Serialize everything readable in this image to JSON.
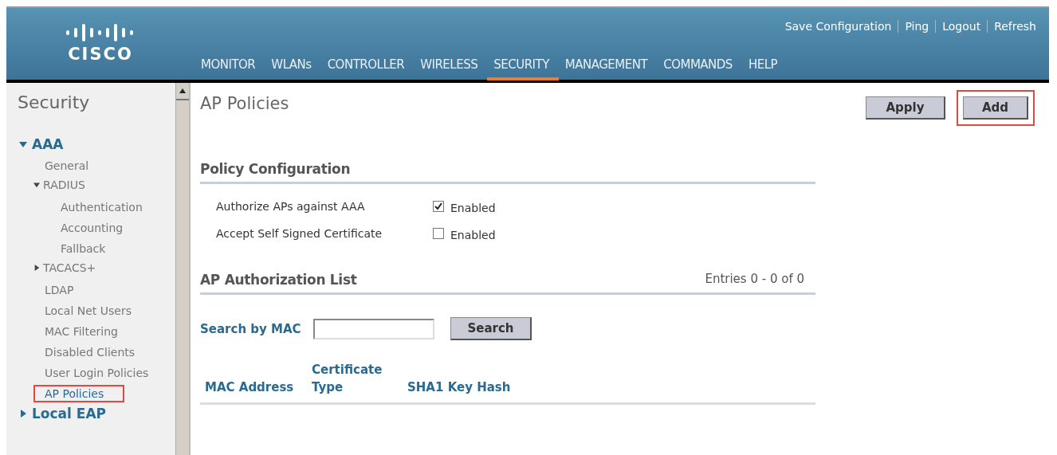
{
  "header": {
    "logo": "CISCO",
    "top_links": [
      "Save Configuration",
      "Ping",
      "Logout",
      "Refresh"
    ],
    "nav": [
      {
        "label": "MONITOR",
        "selected": false
      },
      {
        "label": "WLANs",
        "selected": false
      },
      {
        "label": "CONTROLLER",
        "selected": false
      },
      {
        "label": "WIRELESS",
        "selected": false
      },
      {
        "label": "SECURITY",
        "selected": true
      },
      {
        "label": "MANAGEMENT",
        "selected": false
      },
      {
        "label": "COMMANDS",
        "selected": false
      },
      {
        "label": "HELP",
        "selected": false
      }
    ]
  },
  "sidebar": {
    "title": "Security",
    "items": [
      {
        "label": "AAA",
        "kind": "section",
        "expanded": true,
        "children": [
          {
            "label": "General",
            "selected": false,
            "highlighted": false
          },
          {
            "label": "RADIUS",
            "expanded": true,
            "children": [
              {
                "label": "Authentication",
                "selected": false,
                "highlighted": false
              },
              {
                "label": "Accounting",
                "selected": false,
                "highlighted": false
              },
              {
                "label": "Fallback",
                "selected": false,
                "highlighted": false
              }
            ]
          },
          {
            "label": "TACACS+",
            "expanded": false
          },
          {
            "label": "LDAP",
            "selected": false,
            "highlighted": false
          },
          {
            "label": "Local Net Users",
            "selected": false,
            "highlighted": false
          },
          {
            "label": "MAC Filtering",
            "selected": false,
            "highlighted": false
          },
          {
            "label": "Disabled Clients",
            "selected": false,
            "highlighted": false
          },
          {
            "label": "User Login Policies",
            "selected": false,
            "highlighted": false
          },
          {
            "label": "AP Policies",
            "selected": true,
            "highlighted": true
          }
        ]
      },
      {
        "label": "Local EAP",
        "kind": "section",
        "expanded": false
      }
    ]
  },
  "main": {
    "title": "AP Policies",
    "buttons": [
      {
        "label": "Apply",
        "highlighted": false
      },
      {
        "label": "Add",
        "highlighted": true
      }
    ],
    "policy_section": {
      "title": "Policy Configuration",
      "rows": [
        {
          "label": "Authorize APs against AAA",
          "option": "Enabled",
          "checked": true
        },
        {
          "label": "Accept Self Signed Certificate",
          "option": "Enabled",
          "checked": false
        }
      ]
    },
    "list_section": {
      "title": "AP Authorization List",
      "entries": "Entries 0 - 0 of 0",
      "search": {
        "label": "Search by MAC",
        "button": "Search"
      },
      "columns": [
        "MAC Address",
        "Certificate Type",
        "SHA1 Key Hash"
      ]
    }
  }
}
